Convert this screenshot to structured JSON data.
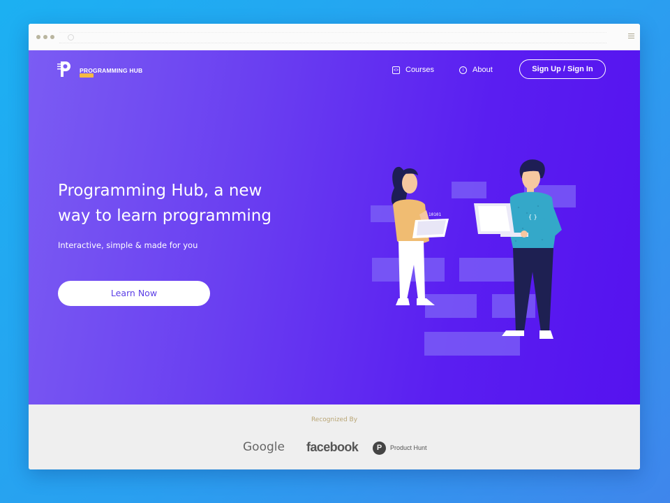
{
  "nav": {
    "brand": "PROGRAMMING HUB",
    "links": [
      {
        "label": "Courses",
        "icon": "code-icon"
      },
      {
        "label": "About",
        "icon": "info-icon"
      }
    ],
    "signup_label": "Sign Up / Sign In"
  },
  "hero": {
    "headline_line1": "Programming Hub, a new",
    "headline_line2": "way to learn programming",
    "subtitle": "Interactive, simple & made for you",
    "cta_label": "Learn Now",
    "tablet_code": "10101"
  },
  "footer": {
    "recognized_label": "Recognized By",
    "brands": [
      "Google",
      "facebook",
      "Product Hunt"
    ]
  },
  "colors": {
    "hero_gradient_start": "#7b5cf3",
    "hero_gradient_end": "#5512ef",
    "accent_badge": "#f5b942",
    "cta_text": "#5b3ee6",
    "page_background": "#1cb0f2"
  }
}
